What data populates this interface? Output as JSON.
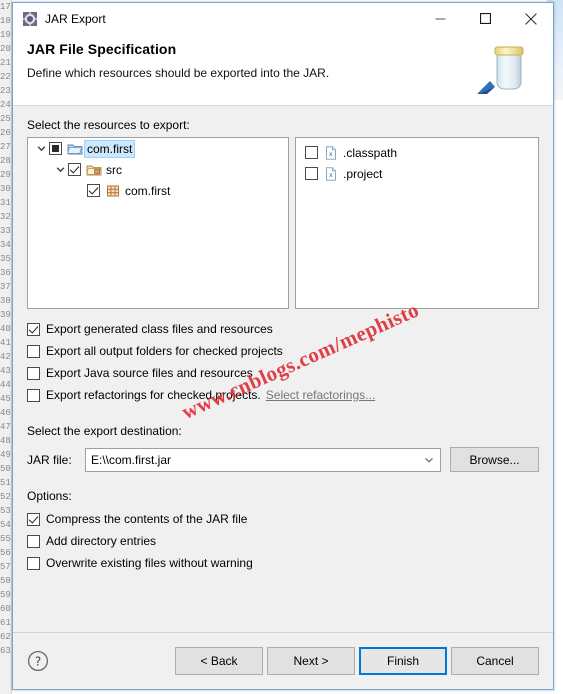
{
  "window": {
    "title": "JAR Export",
    "icon": "jar-export-icon",
    "controls": {
      "minimize": "minimize-icon",
      "maximize": "maximize-icon",
      "close": "close-icon"
    }
  },
  "header": {
    "title": "JAR File Specification",
    "description": "Define which resources should be exported into the JAR.",
    "art": "jar-illustration"
  },
  "resources": {
    "label": "Select the resources to export:",
    "tree": [
      {
        "label": "com.first",
        "check_state": "partial",
        "icon": "project-folder-icon",
        "indent": 0,
        "expanded": true,
        "selected": true
      },
      {
        "label": "src",
        "check_state": "checked",
        "icon": "source-folder-icon",
        "indent": 1,
        "expanded": true,
        "selected": false
      },
      {
        "label": "com.first",
        "check_state": "checked",
        "icon": "package-icon",
        "indent": 2,
        "expanded": false,
        "selected": false
      }
    ],
    "files": [
      {
        "label": ".classpath",
        "check_state": "unchecked",
        "icon": "xml-file-icon"
      },
      {
        "label": ".project",
        "check_state": "unchecked",
        "icon": "xml-file-icon"
      }
    ]
  },
  "export_options": [
    {
      "label": "Export generated class files and resources",
      "check_state": "checked",
      "mnemonic": "c"
    },
    {
      "label": "Export all output folders for checked projects",
      "check_state": "unchecked",
      "mnemonic": "u"
    },
    {
      "label": "Export Java source files and resources",
      "check_state": "unchecked",
      "mnemonic": "s"
    },
    {
      "label": "Export refactorings for checked projects.",
      "check_state": "unchecked",
      "mnemonic": "x"
    }
  ],
  "refactorings_link": "Select refactorings...",
  "destination": {
    "label": "Select the export destination:",
    "field_label": "JAR file:",
    "value": "E:\\\\com.first.jar",
    "dropdown_icon": "chevron-down-icon",
    "browse_label": "Browse..."
  },
  "options": {
    "label": "Options:",
    "items": [
      {
        "label": "Compress the contents of the JAR file",
        "check_state": "checked"
      },
      {
        "label": "Add directory entries",
        "check_state": "unchecked"
      },
      {
        "label": "Overwrite existing files without warning",
        "check_state": "unchecked"
      }
    ]
  },
  "footer": {
    "help_icon": "help-icon",
    "buttons": [
      {
        "label": "< Back",
        "default": false
      },
      {
        "label": "Next >",
        "default": false
      },
      {
        "label": "Finish",
        "default": true
      },
      {
        "label": "Cancel",
        "default": false
      }
    ]
  },
  "watermark": "www.cnblogs.com/mephisto",
  "colors": {
    "accent": "#0078d7",
    "selection": "#cce8ff",
    "dialog_border": "#6fa8dc",
    "watermark": "#e0303a",
    "face": "#f0f0f0"
  }
}
